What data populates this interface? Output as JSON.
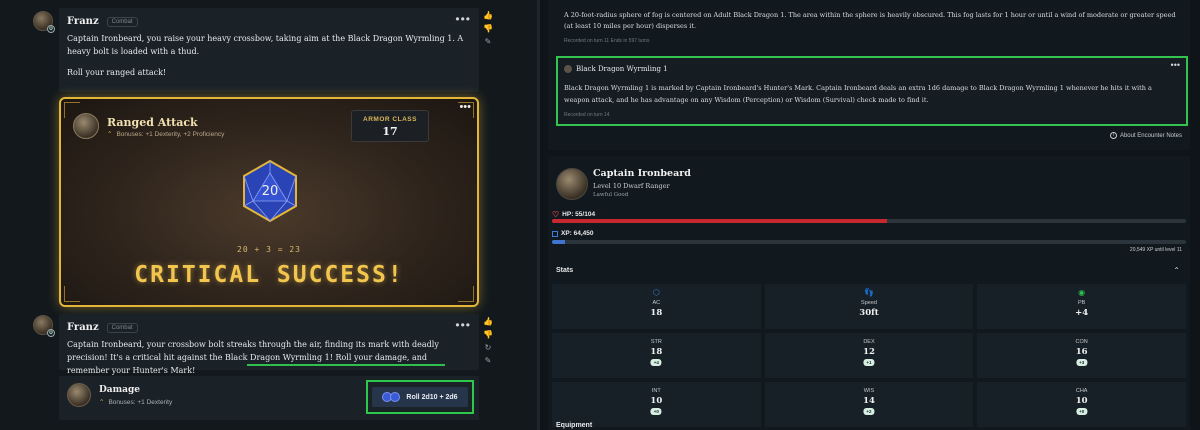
{
  "chat": {
    "message1": {
      "author": "Franz",
      "tag": "Combat",
      "para1": "Captain Ironbeard, you raise your heavy crossbow, taking aim at the Black Dragon Wyrmling 1. A heavy bolt is loaded with a thud.",
      "para2": "Roll your ranged attack!"
    },
    "attack": {
      "title": "Ranged Attack",
      "bonuses": "Bonuses: +1 Dexterity, +2 Proficiency",
      "ac_label": "ARMOR CLASS",
      "ac_value": "17",
      "die_value": "20",
      "formula": "20 + 3 = 23",
      "result": "CRITICAL SUCCESS!"
    },
    "message2": {
      "author": "Franz",
      "tag": "Combat",
      "text_a": "Captain Ironbeard, your crossbow bolt streaks through the air, finding its mark with deadly precision! It's a critical hit against the Black Dragon Wyrmling 1! ",
      "text_b": "Roll your damage, and remember your Hunter's Mark!"
    },
    "damage": {
      "title": "Damage",
      "bonuses": "Bonuses: +1 Dexterity",
      "button_label": "Roll 2d10 + 2d6"
    }
  },
  "notes": {
    "note1": {
      "text": "A 20-foot-radius sphere of fog is centered on Adult Black Dragon 1. The area within the sphere is heavily obscured. This fog lasts for 1 hour or until a wind of moderate or greater speed (at least 10 miles per hour) disperses it.",
      "meta": "Recorded on turn 11   Ends in 597 turns"
    },
    "note2": {
      "title": "Black Dragon Wyrmling 1",
      "text": "Black Dragon Wyrmling 1 is marked by Captain Ironbeard's Hunter's Mark. Captain Ironbeard deals an extra 1d6 damage to Black Dragon Wyrmling 1 whenever he hits it with a weapon attack, and he has advantage on any Wisdom (Perception) or Wisdom (Survival) check made to find it.",
      "meta": "Recorded on turn 14"
    },
    "about_label": "About Encounter Notes"
  },
  "character": {
    "name": "Captain Ironbeard",
    "class_line": "Level 10 Dwarf Ranger",
    "alignment": "Lawful Good",
    "hp_label": "HP: 55/104",
    "hp_fraction": 0.529,
    "xp_label": "XP: 64,450",
    "xp_fraction": 0.02,
    "xp_next": "20,549 XP until level 11",
    "stats_heading": "Stats",
    "equipment_heading": "Equipment",
    "core_stats": [
      {
        "label": "AC",
        "value": "18",
        "icon": "shield-icon",
        "color": "#3f7bd8"
      },
      {
        "label": "Speed",
        "value": "30ft",
        "icon": "footprints-icon",
        "color": "#e0a640"
      },
      {
        "label": "PB",
        "value": "+4",
        "icon": "proficiency-icon",
        "color": "#2fbf4f"
      }
    ],
    "abilities": [
      {
        "label": "STR",
        "value": "18",
        "mod": "+4"
      },
      {
        "label": "DEX",
        "value": "12",
        "mod": "+1"
      },
      {
        "label": "CON",
        "value": "16",
        "mod": "+3"
      },
      {
        "label": "INT",
        "value": "10",
        "mod": "+0"
      },
      {
        "label": "WIS",
        "value": "14",
        "mod": "+2"
      },
      {
        "label": "CHA",
        "value": "10",
        "mod": "+0"
      }
    ]
  },
  "colors": {
    "accent_gold": "#e3b63a",
    "highlight_green": "#2ec84a",
    "hp_red": "#c7282f",
    "xp_blue": "#3f74d0"
  }
}
